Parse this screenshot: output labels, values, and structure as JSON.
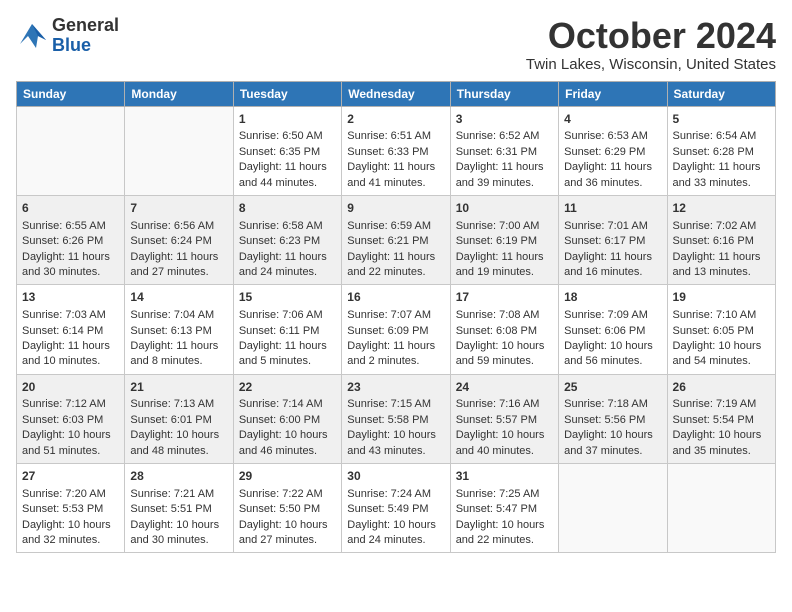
{
  "logo": {
    "line1": "General",
    "line2": "Blue"
  },
  "title": "October 2024",
  "location": "Twin Lakes, Wisconsin, United States",
  "weekdays": [
    "Sunday",
    "Monday",
    "Tuesday",
    "Wednesday",
    "Thursday",
    "Friday",
    "Saturday"
  ],
  "weeks": [
    [
      {
        "day": "",
        "sunrise": "",
        "sunset": "",
        "daylight": ""
      },
      {
        "day": "",
        "sunrise": "",
        "sunset": "",
        "daylight": ""
      },
      {
        "day": "1",
        "sunrise": "Sunrise: 6:50 AM",
        "sunset": "Sunset: 6:35 PM",
        "daylight": "Daylight: 11 hours and 44 minutes."
      },
      {
        "day": "2",
        "sunrise": "Sunrise: 6:51 AM",
        "sunset": "Sunset: 6:33 PM",
        "daylight": "Daylight: 11 hours and 41 minutes."
      },
      {
        "day": "3",
        "sunrise": "Sunrise: 6:52 AM",
        "sunset": "Sunset: 6:31 PM",
        "daylight": "Daylight: 11 hours and 39 minutes."
      },
      {
        "day": "4",
        "sunrise": "Sunrise: 6:53 AM",
        "sunset": "Sunset: 6:29 PM",
        "daylight": "Daylight: 11 hours and 36 minutes."
      },
      {
        "day": "5",
        "sunrise": "Sunrise: 6:54 AM",
        "sunset": "Sunset: 6:28 PM",
        "daylight": "Daylight: 11 hours and 33 minutes."
      }
    ],
    [
      {
        "day": "6",
        "sunrise": "Sunrise: 6:55 AM",
        "sunset": "Sunset: 6:26 PM",
        "daylight": "Daylight: 11 hours and 30 minutes."
      },
      {
        "day": "7",
        "sunrise": "Sunrise: 6:56 AM",
        "sunset": "Sunset: 6:24 PM",
        "daylight": "Daylight: 11 hours and 27 minutes."
      },
      {
        "day": "8",
        "sunrise": "Sunrise: 6:58 AM",
        "sunset": "Sunset: 6:23 PM",
        "daylight": "Daylight: 11 hours and 24 minutes."
      },
      {
        "day": "9",
        "sunrise": "Sunrise: 6:59 AM",
        "sunset": "Sunset: 6:21 PM",
        "daylight": "Daylight: 11 hours and 22 minutes."
      },
      {
        "day": "10",
        "sunrise": "Sunrise: 7:00 AM",
        "sunset": "Sunset: 6:19 PM",
        "daylight": "Daylight: 11 hours and 19 minutes."
      },
      {
        "day": "11",
        "sunrise": "Sunrise: 7:01 AM",
        "sunset": "Sunset: 6:17 PM",
        "daylight": "Daylight: 11 hours and 16 minutes."
      },
      {
        "day": "12",
        "sunrise": "Sunrise: 7:02 AM",
        "sunset": "Sunset: 6:16 PM",
        "daylight": "Daylight: 11 hours and 13 minutes."
      }
    ],
    [
      {
        "day": "13",
        "sunrise": "Sunrise: 7:03 AM",
        "sunset": "Sunset: 6:14 PM",
        "daylight": "Daylight: 11 hours and 10 minutes."
      },
      {
        "day": "14",
        "sunrise": "Sunrise: 7:04 AM",
        "sunset": "Sunset: 6:13 PM",
        "daylight": "Daylight: 11 hours and 8 minutes."
      },
      {
        "day": "15",
        "sunrise": "Sunrise: 7:06 AM",
        "sunset": "Sunset: 6:11 PM",
        "daylight": "Daylight: 11 hours and 5 minutes."
      },
      {
        "day": "16",
        "sunrise": "Sunrise: 7:07 AM",
        "sunset": "Sunset: 6:09 PM",
        "daylight": "Daylight: 11 hours and 2 minutes."
      },
      {
        "day": "17",
        "sunrise": "Sunrise: 7:08 AM",
        "sunset": "Sunset: 6:08 PM",
        "daylight": "Daylight: 10 hours and 59 minutes."
      },
      {
        "day": "18",
        "sunrise": "Sunrise: 7:09 AM",
        "sunset": "Sunset: 6:06 PM",
        "daylight": "Daylight: 10 hours and 56 minutes."
      },
      {
        "day": "19",
        "sunrise": "Sunrise: 7:10 AM",
        "sunset": "Sunset: 6:05 PM",
        "daylight": "Daylight: 10 hours and 54 minutes."
      }
    ],
    [
      {
        "day": "20",
        "sunrise": "Sunrise: 7:12 AM",
        "sunset": "Sunset: 6:03 PM",
        "daylight": "Daylight: 10 hours and 51 minutes."
      },
      {
        "day": "21",
        "sunrise": "Sunrise: 7:13 AM",
        "sunset": "Sunset: 6:01 PM",
        "daylight": "Daylight: 10 hours and 48 minutes."
      },
      {
        "day": "22",
        "sunrise": "Sunrise: 7:14 AM",
        "sunset": "Sunset: 6:00 PM",
        "daylight": "Daylight: 10 hours and 46 minutes."
      },
      {
        "day": "23",
        "sunrise": "Sunrise: 7:15 AM",
        "sunset": "Sunset: 5:58 PM",
        "daylight": "Daylight: 10 hours and 43 minutes."
      },
      {
        "day": "24",
        "sunrise": "Sunrise: 7:16 AM",
        "sunset": "Sunset: 5:57 PM",
        "daylight": "Daylight: 10 hours and 40 minutes."
      },
      {
        "day": "25",
        "sunrise": "Sunrise: 7:18 AM",
        "sunset": "Sunset: 5:56 PM",
        "daylight": "Daylight: 10 hours and 37 minutes."
      },
      {
        "day": "26",
        "sunrise": "Sunrise: 7:19 AM",
        "sunset": "Sunset: 5:54 PM",
        "daylight": "Daylight: 10 hours and 35 minutes."
      }
    ],
    [
      {
        "day": "27",
        "sunrise": "Sunrise: 7:20 AM",
        "sunset": "Sunset: 5:53 PM",
        "daylight": "Daylight: 10 hours and 32 minutes."
      },
      {
        "day": "28",
        "sunrise": "Sunrise: 7:21 AM",
        "sunset": "Sunset: 5:51 PM",
        "daylight": "Daylight: 10 hours and 30 minutes."
      },
      {
        "day": "29",
        "sunrise": "Sunrise: 7:22 AM",
        "sunset": "Sunset: 5:50 PM",
        "daylight": "Daylight: 10 hours and 27 minutes."
      },
      {
        "day": "30",
        "sunrise": "Sunrise: 7:24 AM",
        "sunset": "Sunset: 5:49 PM",
        "daylight": "Daylight: 10 hours and 24 minutes."
      },
      {
        "day": "31",
        "sunrise": "Sunrise: 7:25 AM",
        "sunset": "Sunset: 5:47 PM",
        "daylight": "Daylight: 10 hours and 22 minutes."
      },
      {
        "day": "",
        "sunrise": "",
        "sunset": "",
        "daylight": ""
      },
      {
        "day": "",
        "sunrise": "",
        "sunset": "",
        "daylight": ""
      }
    ]
  ]
}
